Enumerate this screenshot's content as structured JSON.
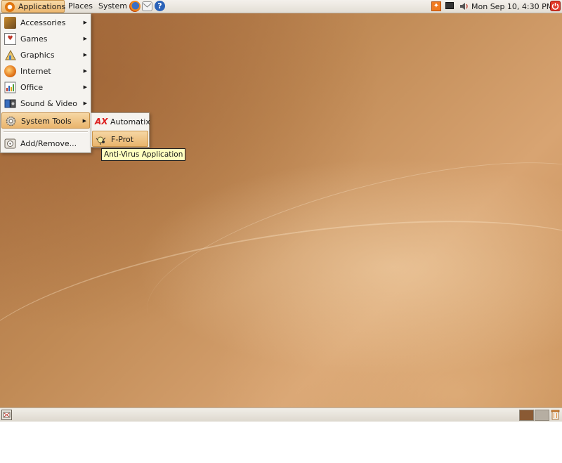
{
  "top_panel": {
    "menus": {
      "applications": "Applications",
      "places": "Places",
      "system": "System"
    },
    "launchers": [
      "firefox-icon",
      "mail-icon",
      "help-icon"
    ],
    "tray": [
      "update-notifier-icon",
      "network-icon",
      "volume-icon"
    ],
    "clock": "Mon Sep 10,  4:30 PM"
  },
  "applications_menu": {
    "items": [
      {
        "label": "Accessories",
        "icon": "accessories-icon",
        "submenu": true
      },
      {
        "label": "Games",
        "icon": "games-icon",
        "submenu": true
      },
      {
        "label": "Graphics",
        "icon": "graphics-icon",
        "submenu": true
      },
      {
        "label": "Internet",
        "icon": "internet-icon",
        "submenu": true
      },
      {
        "label": "Office",
        "icon": "office-icon",
        "submenu": true
      },
      {
        "label": "Sound & Video",
        "icon": "sound-video-icon",
        "submenu": true
      },
      {
        "label": "System Tools",
        "icon": "system-tools-icon",
        "submenu": true,
        "highlighted": true
      },
      {
        "label": "Add/Remove...",
        "icon": "add-remove-icon",
        "submenu": false
      }
    ],
    "arrow": "▶"
  },
  "system_tools_submenu": {
    "items": [
      {
        "label": "Automatix",
        "icon": "automatix-icon"
      },
      {
        "label": "F-Prot",
        "icon": "f-prot-icon",
        "highlighted": true
      }
    ]
  },
  "tooltip": "Anti-Virus Application",
  "bottom_panel": {
    "workspaces": [
      {
        "active": true,
        "color": "#8a5a34"
      },
      {
        "active": false,
        "color": "#b6aea2"
      }
    ]
  },
  "colors": {
    "accent": "#e9b46c",
    "panel": "#ebe7df",
    "desktop": "#c08a55"
  }
}
